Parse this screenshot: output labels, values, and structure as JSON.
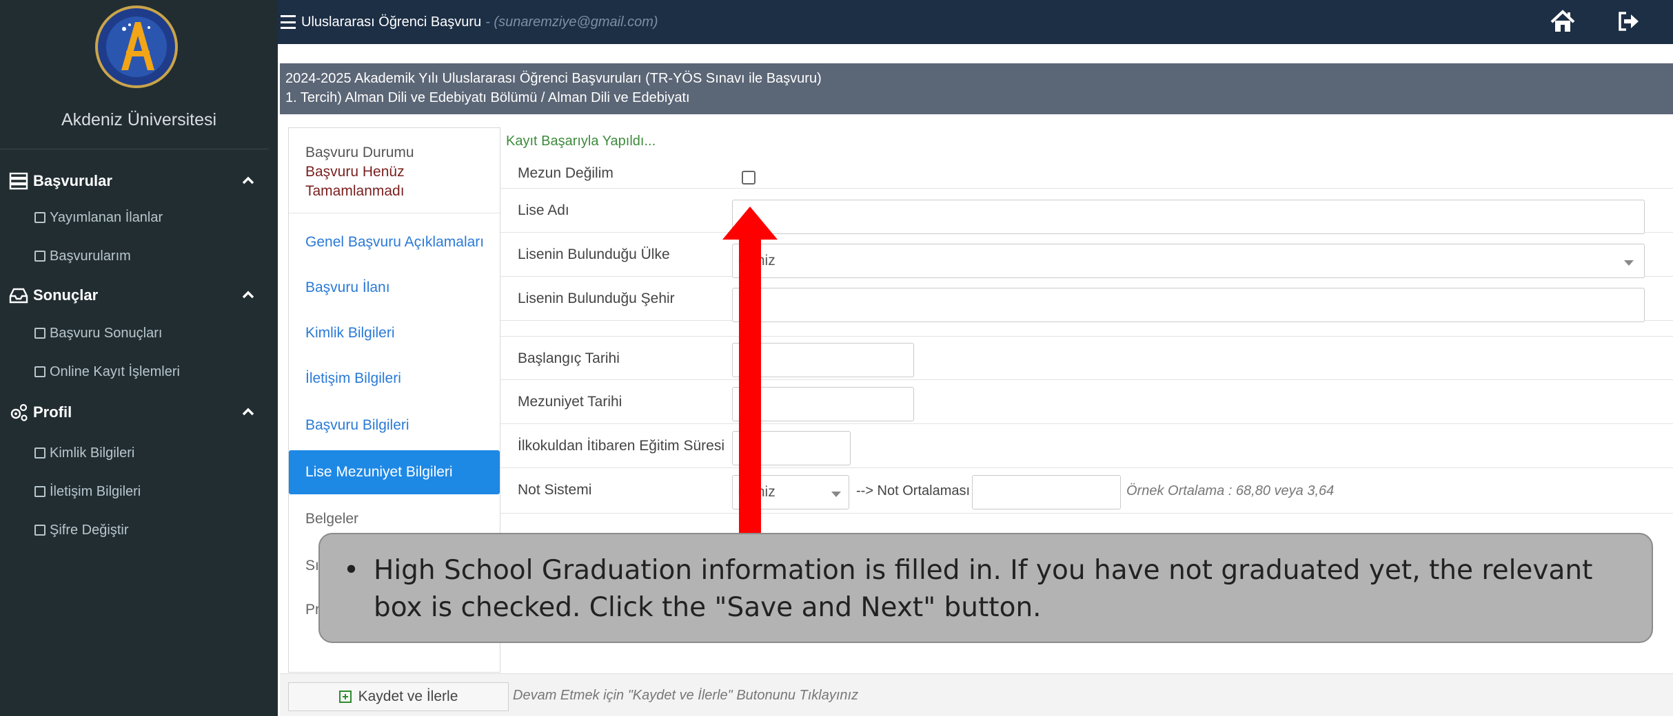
{
  "sidebar": {
    "brand": "Akdeniz Üniversitesi",
    "sections": [
      {
        "label": "Başvurular",
        "icon": "server-stack-icon",
        "items": [
          "Yayımlanan İlanlar",
          "Başvurularım"
        ]
      },
      {
        "label": "Sonuçlar",
        "icon": "inbox-icon",
        "items": [
          "Başvuru Sonuçları",
          "Online Kayıt İşlemleri"
        ]
      },
      {
        "label": "Profil",
        "icon": "gears-icon",
        "items": [
          "Kimlik Bilgileri",
          "İletişim Bilgileri",
          "Şifre Değiştir"
        ]
      }
    ]
  },
  "header": {
    "title": "Uluslararası Öğrenci Başvuru",
    "email": "- (sunaremziye@gmail.com)"
  },
  "breadcrumb": {
    "line1": "2024-2025 Akademik Yılı Uluslararası Öğrenci Başvuruları (TR-YÖS Sınavı ile Başvuru)",
    "line2": "1. Tercih) Alman Dili ve Edebiyatı Bölümü / Alman Dili ve Edebiyatı"
  },
  "status": {
    "label": "Başvuru Durumu",
    "value_line1": "Başvuru Henüz",
    "value_line2": "Tamamlanmadı"
  },
  "nav": [
    "Genel Başvuru Açıklamaları",
    "Başvuru İlanı",
    "Kimlik Bilgileri",
    "İletişim Bilgileri",
    "Başvuru Bilgileri",
    "Lise Mezuniyet Bilgileri",
    "Belgeler",
    "Sı",
    "Pr"
  ],
  "form": {
    "success_message": "Kayıt Başarıyla Yapıldı...",
    "labels": {
      "not_graduated": "Mezun Değilim",
      "school_name": "Lise Adı",
      "school_country": "Lisenin Bulunduğu Ülke",
      "school_city": "Lisenin Bulunduğu Şehir",
      "start_date": "Başlangıç Tarihi",
      "graduation_date": "Mezuniyet Tarihi",
      "education_duration": "İlkokuldan İtibaren Eğitim Süresi",
      "grading_system": "Not Sistemi"
    },
    "country_select_value": "eçiniz",
    "grading_select_value": "eçiniz",
    "gpa_label": "--> Not Ortalaması",
    "gpa_example": "Örnek Ortalama : 68,80 veya 3,64"
  },
  "callout": {
    "text": "High School Graduation information is filled in. If you have not graduated yet, the relevant box is checked. Click the \"Save and Next\" button."
  },
  "footer": {
    "save_button": "Kaydet ve İlerle",
    "hint": "Devam Etmek için \"Kaydet ve İlerle\" Butonunu Tıklayınız"
  },
  "colors": {
    "sidebar_bg": "#222d32",
    "header_bg": "#1d2f45",
    "breadcrumb_bg": "#5b6676",
    "active_nav": "#1e88e5",
    "annotation_arrow": "#ff0000",
    "callout_bg": "#b3b3b3"
  }
}
